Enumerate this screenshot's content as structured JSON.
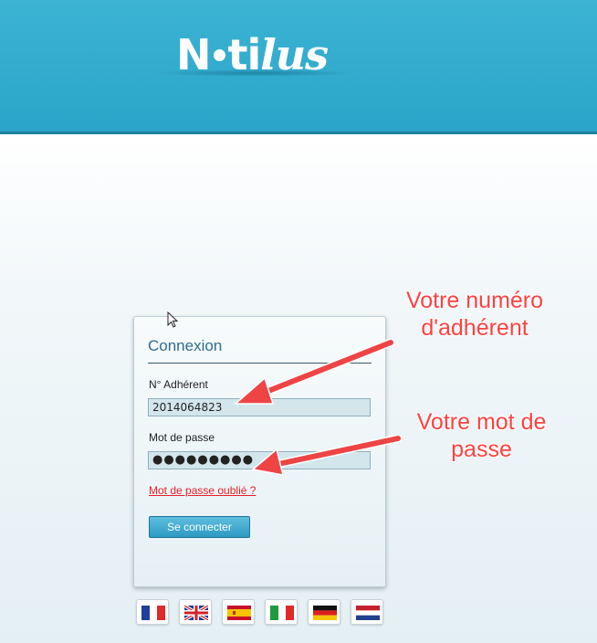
{
  "header": {
    "logo_prefix": "N",
    "logo_mid": "ti",
    "logo_script": "lus",
    "bg_color": "#2aa5c9"
  },
  "login": {
    "title": "Connexion",
    "member_label": "N° Adhérent",
    "member_value": "2014064823",
    "password_label": "Mot de passe",
    "password_value": "●●●●●●●●●",
    "forgot_link": "Mot de passe oublié ?",
    "submit_label": "Se connecter",
    "accent_color": "#2f6e8e",
    "link_color": "#e8202a"
  },
  "languages": [
    {
      "icon": "flag-france-icon"
    },
    {
      "icon": "flag-uk-icon"
    },
    {
      "icon": "flag-spain-icon"
    },
    {
      "icon": "flag-italy-icon"
    },
    {
      "icon": "flag-germany-icon"
    },
    {
      "icon": "flag-netherlands-icon"
    }
  ],
  "annotations": {
    "member_line1": "Votre numéro",
    "member_line2": "d'adhérent",
    "password_line1": "Votre mot de",
    "password_line2": "passe",
    "color": "#ff4040"
  }
}
